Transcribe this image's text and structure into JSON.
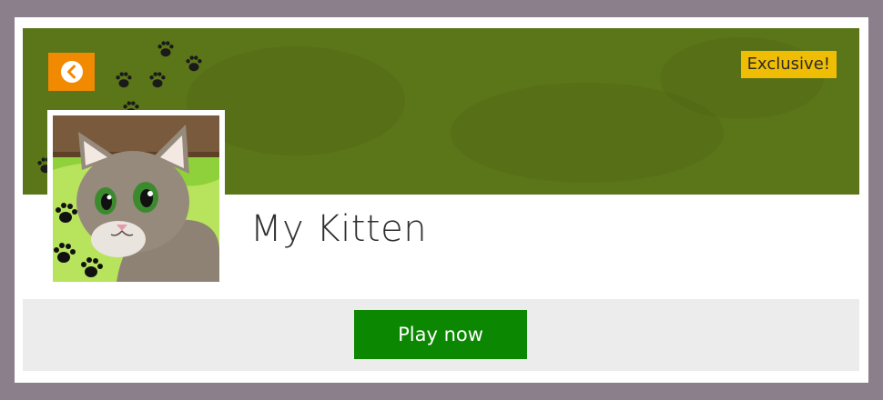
{
  "card": {
    "exclusive_label": "Exclusive!",
    "title": "My Kitten",
    "play_label": "Play now"
  },
  "colors": {
    "page_background": "#8a7f8a",
    "banner": "#5b7519",
    "back_button": "#f18a00",
    "exclusive_badge": "#f0bd05",
    "play_button": "#0b8701",
    "footer_bar": "#ececec"
  },
  "icons": {
    "back": "chevron-left-icon",
    "decor": "paw-print-icon",
    "avatar": "kitten-avatar"
  }
}
